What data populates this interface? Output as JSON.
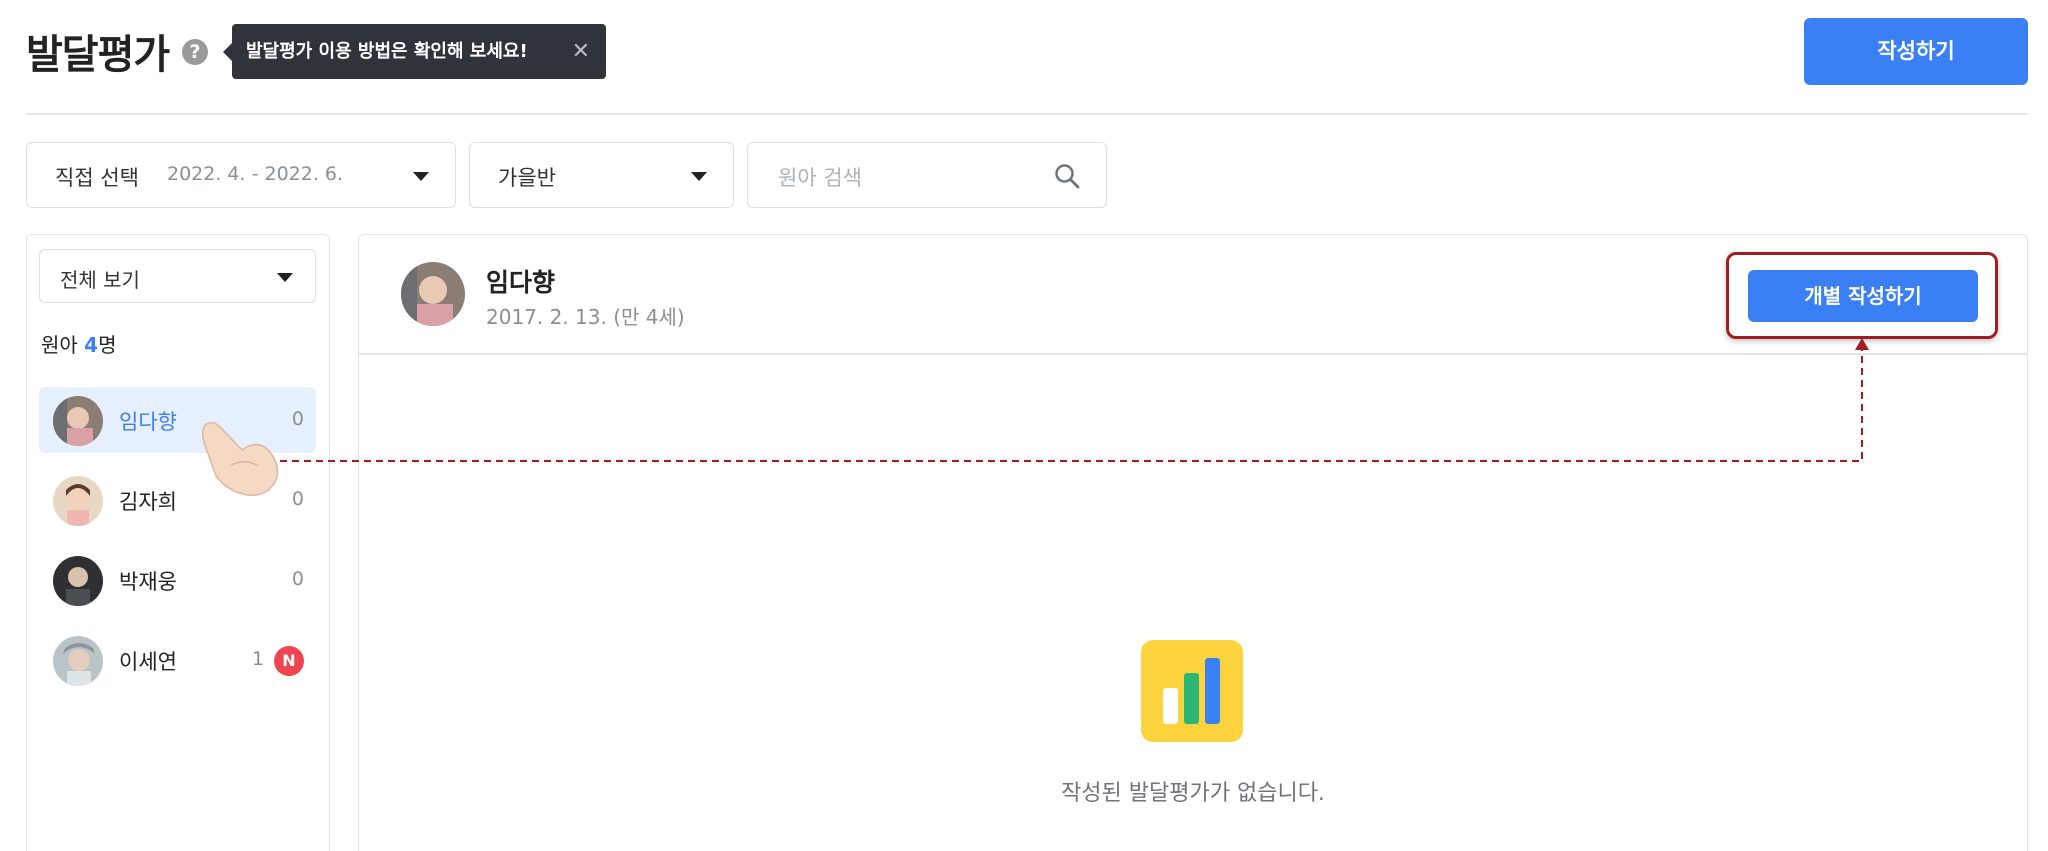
{
  "header": {
    "title": "발달평가",
    "help_icon": "question-circle-icon",
    "tooltip": {
      "text": "발달평가 이용 방법은 확인해 보세요!",
      "close": "✕"
    },
    "create_button": "작성하기"
  },
  "filters": {
    "period": {
      "label": "직접 선택",
      "range": "2022. 4. - 2022. 6."
    },
    "class": {
      "label": "가을반"
    },
    "search": {
      "placeholder": "원아 검색",
      "icon": "search-icon"
    }
  },
  "sidebar": {
    "view_select": "전체 보기",
    "count_label": "원아",
    "count_value": "4",
    "count_unit": "명",
    "children": [
      {
        "name": "임다향",
        "count": "0",
        "selected": true
      },
      {
        "name": "김자희",
        "count": "0"
      },
      {
        "name": "박재웅",
        "count": "0"
      },
      {
        "name": "이세연",
        "count": "1",
        "badge": "N"
      }
    ]
  },
  "detail": {
    "name": "임다향",
    "birth": "2017. 2. 13. (만 4세)",
    "individual_button": "개별 작성하기",
    "empty_message": "작성된 발달평가가 없습니다.",
    "empty_icon": "bar-chart-icon"
  },
  "colors": {
    "primary": "#3b7ff5",
    "highlight": "#a31c22",
    "badge": "#f04452",
    "empty_icon_bg": "#fcd33c"
  }
}
